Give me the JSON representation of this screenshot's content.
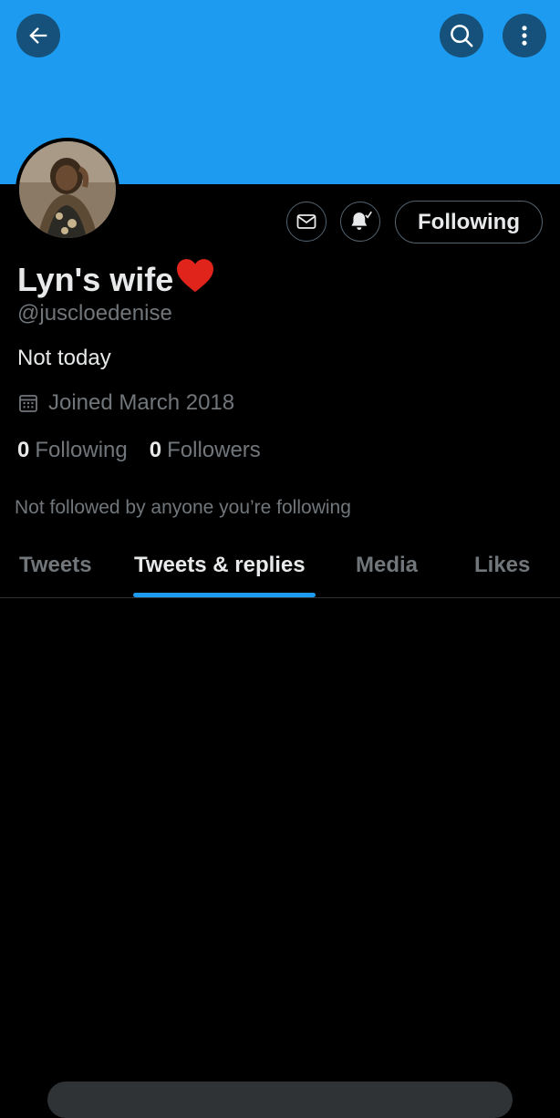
{
  "header": {
    "back_icon": "arrow-left-icon",
    "search_icon": "search-icon",
    "more_icon": "more-vertical-icon",
    "banner_color": "#1d9bf0"
  },
  "profile": {
    "display_name": "Lyn's wife",
    "name_emoji": "heart-icon",
    "handle": "@juscloedenise",
    "bio": "Not today",
    "joined": "Joined March 2018",
    "following_count": "0",
    "following_label": "Following",
    "followers_count": "0",
    "followers_label": "Followers",
    "not_followed_text": "Not followed by anyone you’re following"
  },
  "actions": {
    "message_icon": "envelope-icon",
    "notify_icon": "bell-check-icon",
    "follow_button_label": "Following"
  },
  "tabs": [
    {
      "label": "Tweets",
      "active": false
    },
    {
      "label": "Tweets & replies",
      "active": true
    },
    {
      "label": "Media",
      "active": false
    },
    {
      "label": "Likes",
      "active": false
    }
  ],
  "colors": {
    "accent": "#1d9bf0",
    "background": "#000000",
    "text_primary": "#e7e9ea",
    "text_secondary": "#71767b",
    "heart": "#e0241b"
  }
}
